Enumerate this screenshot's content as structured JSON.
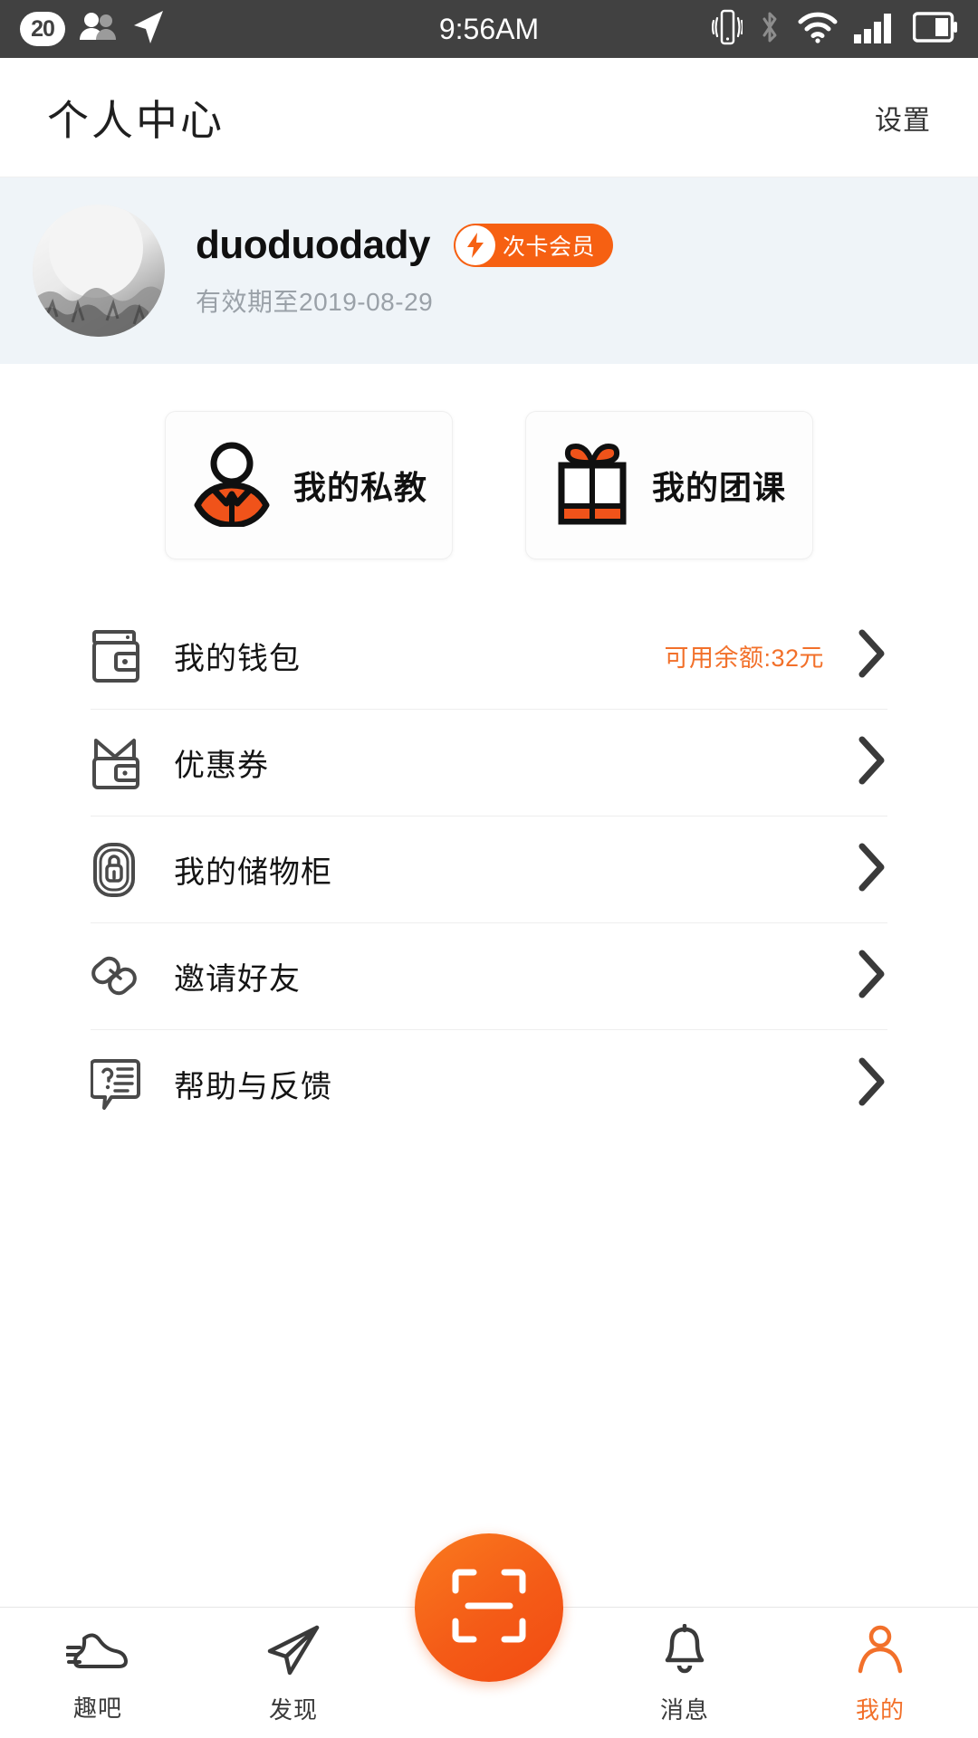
{
  "status_bar": {
    "notification_count": "20",
    "time": "9:56AM",
    "icons": [
      "contacts-icon",
      "location-arrow-icon",
      "vibrate-icon",
      "bluetooth-icon",
      "wifi-icon",
      "cellular-signal-icon",
      "battery-icon"
    ]
  },
  "header": {
    "title": "个人中心",
    "settings_label": "设置"
  },
  "profile": {
    "username": "duoduodady",
    "vip_badge_label": "次卡会员",
    "validity": "有效期至2019-08-29",
    "avatar_alt": "user-avatar"
  },
  "cards": [
    {
      "label": "我的私教",
      "icon": "trainer-person-icon"
    },
    {
      "label": "我的团课",
      "icon": "gift-box-icon"
    }
  ],
  "menu": [
    {
      "label": "我的钱包",
      "icon": "wallet-icon",
      "value": "可用余额:32元"
    },
    {
      "label": "优惠券",
      "icon": "coupon-icon",
      "value": ""
    },
    {
      "label": "我的储物柜",
      "icon": "locker-lock-icon",
      "value": ""
    },
    {
      "label": "邀请好友",
      "icon": "chain-link-icon",
      "value": ""
    },
    {
      "label": "帮助与反馈",
      "icon": "help-bubble-icon",
      "value": ""
    }
  ],
  "tabbar": {
    "items": [
      {
        "label": "趣吧",
        "icon": "shoe-icon",
        "active": false
      },
      {
        "label": "发现",
        "icon": "paper-plane-icon",
        "active": false
      },
      {
        "label": "消息",
        "icon": "bell-icon",
        "active": false
      },
      {
        "label": "我的",
        "icon": "person-icon",
        "active": true
      }
    ],
    "scan_button_icon": "qr-scan-icon"
  },
  "colors": {
    "accent_orange": "#f2702a",
    "badge_orange": "#f66012",
    "profile_bg": "#eff4f8",
    "status_bar_bg": "#414141",
    "icon_gray": "#4a4a4a"
  }
}
